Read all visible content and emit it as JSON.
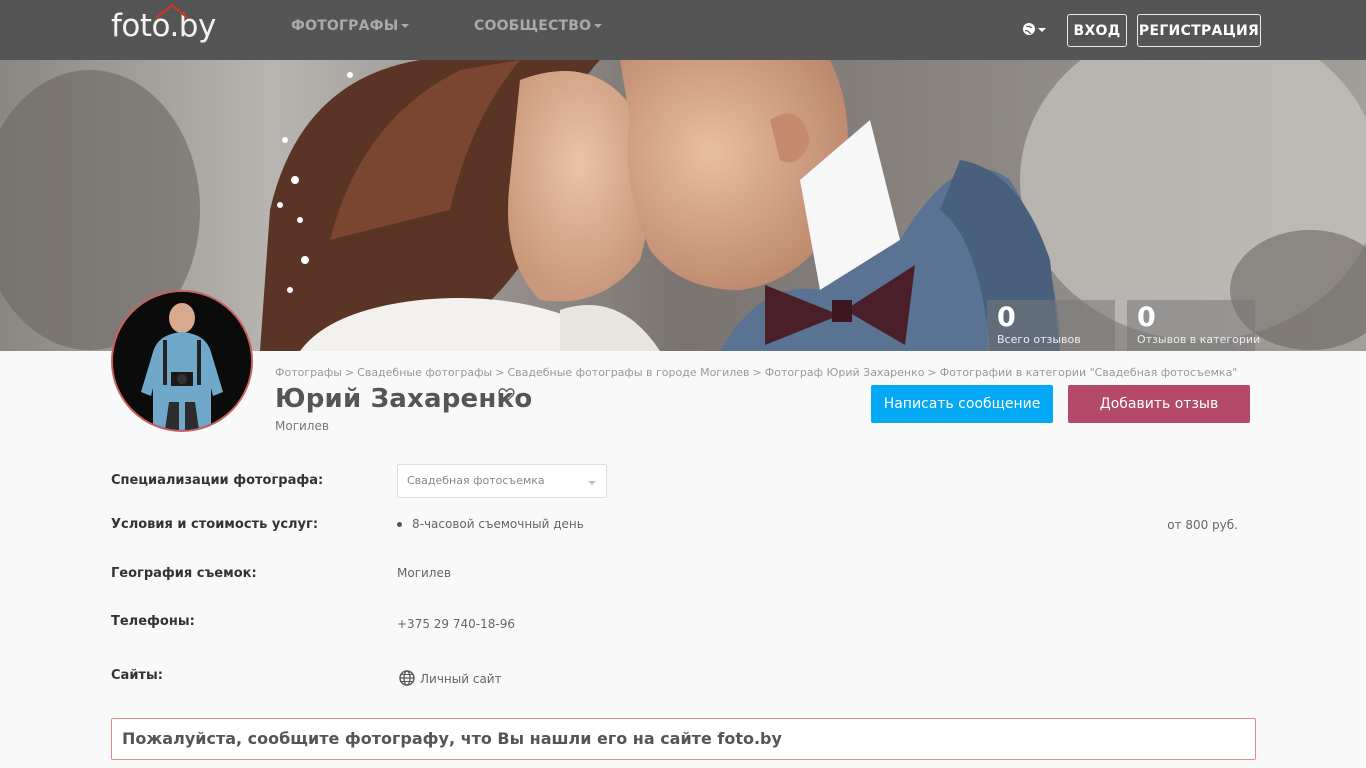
{
  "header": {
    "logo": "foto.by",
    "nav": [
      {
        "label": "ФОТОГРАФЫ"
      },
      {
        "label": "СООБЩЕСТВО"
      }
    ],
    "login_label": "ВХОД",
    "register_label": "РЕГИСТРАЦИЯ",
    "language_icon": "globe-icon"
  },
  "stats": [
    {
      "value": "0",
      "label": "Всего отзывов"
    },
    {
      "value": "0",
      "label": "Отзывов в категории"
    }
  ],
  "breadcrumb": [
    "Фотографы",
    "Свадебные фотографы",
    "Свадебные фотографы в городе Могилев",
    "Фотограф Юрий Захаренко",
    "Фотографии в категории \"Свадебная фотосъемка\""
  ],
  "profile": {
    "name": "Юрий Захаренко",
    "city": "Могилев",
    "message_button": "Написать сообщение",
    "review_button": "Добавить отзыв"
  },
  "details": {
    "specializations_label": "Специализации фотографа:",
    "specialization_selected": "Свадебная фотосъемка",
    "services_label": "Условия и стоимость услуг:",
    "service_item": "8-часовой съемочный день",
    "service_price": "от 800 руб.",
    "geography_label": "География съемок:",
    "geography_value": "Могилев",
    "phones_label": "Телефоны:",
    "phone_value": "+375 29 740-18-96",
    "sites_label": "Сайты:",
    "site_value": "Личный сайт"
  },
  "notice": "Пожалуйста, сообщите фотографу, что Вы нашли его на сайте foto.by",
  "colors": {
    "header_bg": "#555555",
    "primary": "#03a9f4",
    "review": "#b5496a",
    "notice_border": "#e08a8a"
  }
}
